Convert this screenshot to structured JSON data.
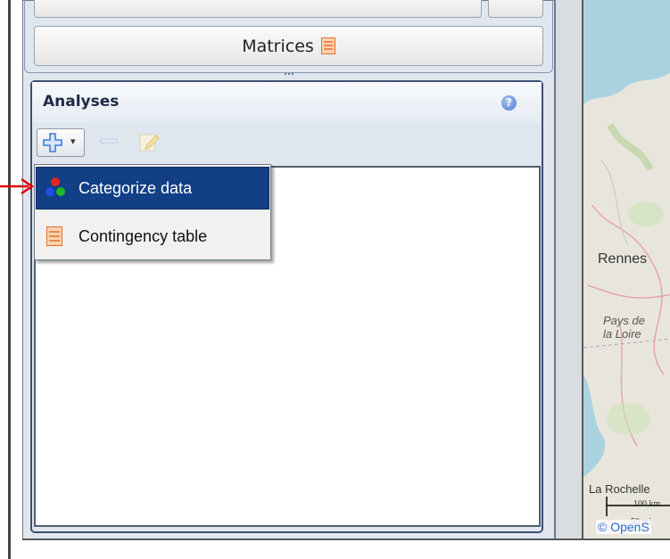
{
  "window": {
    "matrices_button": "Matrices"
  },
  "analyses_panel": {
    "title": "Analyses",
    "help_icon": "help-icon",
    "toolbar": {
      "add_icon": "plus-icon",
      "remove_icon": "minus-icon",
      "edit_icon": "edit-icon"
    },
    "menu": {
      "items": [
        {
          "label": "Categorize data",
          "icon": "categorize-icon",
          "highlighted": true
        },
        {
          "label": "Contingency table",
          "icon": "table-icon",
          "highlighted": false
        }
      ]
    }
  },
  "map": {
    "labels": {
      "rennes": "Rennes",
      "region_line1": "Pays de",
      "region_line2": "la Loire",
      "la_rochelle": "La Rochelle"
    },
    "scale": {
      "km": "100 km",
      "mi": "50 mi"
    },
    "attribution": "© OpenS"
  },
  "colors": {
    "menu_highlight": "#123f86",
    "panel_border": "#3c4f73",
    "arrow": "#e00000"
  }
}
